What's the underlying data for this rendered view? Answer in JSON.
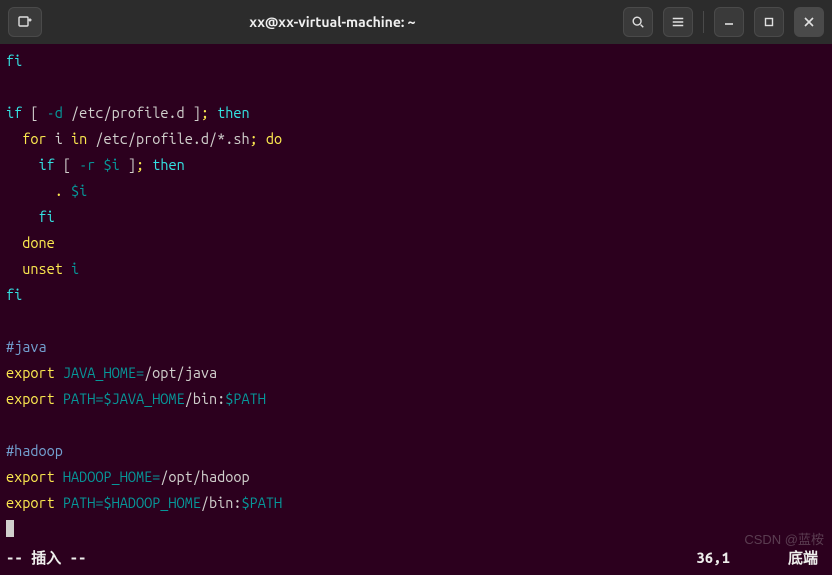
{
  "titlebar": {
    "title": "xx@xx-virtual-machine: ~",
    "icons": {
      "newtab": "new-tab-icon",
      "search": "search-icon",
      "menu": "hamburger-icon",
      "min": "minimize-icon",
      "max": "maximize-icon",
      "close": "close-icon"
    }
  },
  "editor": {
    "lines": [
      {
        "segments": [
          {
            "t": "fi",
            "c": "c-cyan"
          }
        ]
      },
      {
        "segments": []
      },
      {
        "segments": [
          {
            "t": "if",
            "c": "c-cyan"
          },
          {
            "t": " [ ",
            "c": "c-white"
          },
          {
            "t": "-d",
            "c": "c-teal"
          },
          {
            "t": " /etc/profile.d ]",
            "c": "c-white"
          },
          {
            "t": ";",
            "c": "c-yellow"
          },
          {
            "t": " ",
            "c": "c-white"
          },
          {
            "t": "then",
            "c": "c-cyan"
          }
        ]
      },
      {
        "segments": [
          {
            "t": "  ",
            "c": "c-white"
          },
          {
            "t": "for",
            "c": "c-yellow"
          },
          {
            "t": " i ",
            "c": "c-white"
          },
          {
            "t": "in",
            "c": "c-yellow"
          },
          {
            "t": " /etc/profile.d/*.sh",
            "c": "c-white"
          },
          {
            "t": ";",
            "c": "c-yellow"
          },
          {
            "t": " ",
            "c": "c-white"
          },
          {
            "t": "do",
            "c": "c-yellow"
          }
        ]
      },
      {
        "segments": [
          {
            "t": "    ",
            "c": "c-white"
          },
          {
            "t": "if",
            "c": "c-cyan"
          },
          {
            "t": " [ ",
            "c": "c-white"
          },
          {
            "t": "-r",
            "c": "c-teal"
          },
          {
            "t": " ",
            "c": "c-white"
          },
          {
            "t": "$i",
            "c": "c-teal"
          },
          {
            "t": " ]",
            "c": "c-white"
          },
          {
            "t": ";",
            "c": "c-yellow"
          },
          {
            "t": " ",
            "c": "c-white"
          },
          {
            "t": "then",
            "c": "c-cyan"
          }
        ]
      },
      {
        "segments": [
          {
            "t": "      ",
            "c": "c-white"
          },
          {
            "t": ".",
            "c": "c-yellow"
          },
          {
            "t": " ",
            "c": "c-white"
          },
          {
            "t": "$i",
            "c": "c-teal"
          }
        ]
      },
      {
        "segments": [
          {
            "t": "    ",
            "c": "c-white"
          },
          {
            "t": "fi",
            "c": "c-cyan"
          }
        ]
      },
      {
        "segments": [
          {
            "t": "  ",
            "c": "c-white"
          },
          {
            "t": "done",
            "c": "c-yellow"
          }
        ]
      },
      {
        "segments": [
          {
            "t": "  ",
            "c": "c-white"
          },
          {
            "t": "unset",
            "c": "c-yellow"
          },
          {
            "t": " ",
            "c": "c-white"
          },
          {
            "t": "i",
            "c": "c-teal"
          }
        ]
      },
      {
        "segments": [
          {
            "t": "fi",
            "c": "c-cyan"
          }
        ]
      },
      {
        "segments": []
      },
      {
        "segments": [
          {
            "t": "#java",
            "c": "c-comment"
          }
        ]
      },
      {
        "segments": [
          {
            "t": "export",
            "c": "c-yellow"
          },
          {
            "t": " ",
            "c": "c-white"
          },
          {
            "t": "JAVA_HOME=",
            "c": "c-teal"
          },
          {
            "t": "/opt/java",
            "c": "c-white"
          }
        ]
      },
      {
        "segments": [
          {
            "t": "export",
            "c": "c-yellow"
          },
          {
            "t": " ",
            "c": "c-white"
          },
          {
            "t": "PATH=",
            "c": "c-teal"
          },
          {
            "t": "$JAVA_HOME",
            "c": "c-teal"
          },
          {
            "t": "/bin:",
            "c": "c-white"
          },
          {
            "t": "$PATH",
            "c": "c-teal"
          }
        ]
      },
      {
        "segments": []
      },
      {
        "segments": [
          {
            "t": "#hadoop",
            "c": "c-comment"
          }
        ]
      },
      {
        "segments": [
          {
            "t": "export",
            "c": "c-yellow"
          },
          {
            "t": " ",
            "c": "c-white"
          },
          {
            "t": "HADOOP_HOME=",
            "c": "c-teal"
          },
          {
            "t": "/opt/hadoop",
            "c": "c-white"
          }
        ]
      },
      {
        "segments": [
          {
            "t": "export",
            "c": "c-yellow"
          },
          {
            "t": " ",
            "c": "c-white"
          },
          {
            "t": "PATH=",
            "c": "c-teal"
          },
          {
            "t": "$HADOOP_HOME",
            "c": "c-teal"
          },
          {
            "t": "/bin:",
            "c": "c-white"
          },
          {
            "t": "$PATH",
            "c": "c-teal"
          }
        ]
      }
    ],
    "status": {
      "mode": "-- 插入 --",
      "position": "36,1",
      "percent": "底端"
    }
  },
  "watermark": "CSDN @蓝桉"
}
